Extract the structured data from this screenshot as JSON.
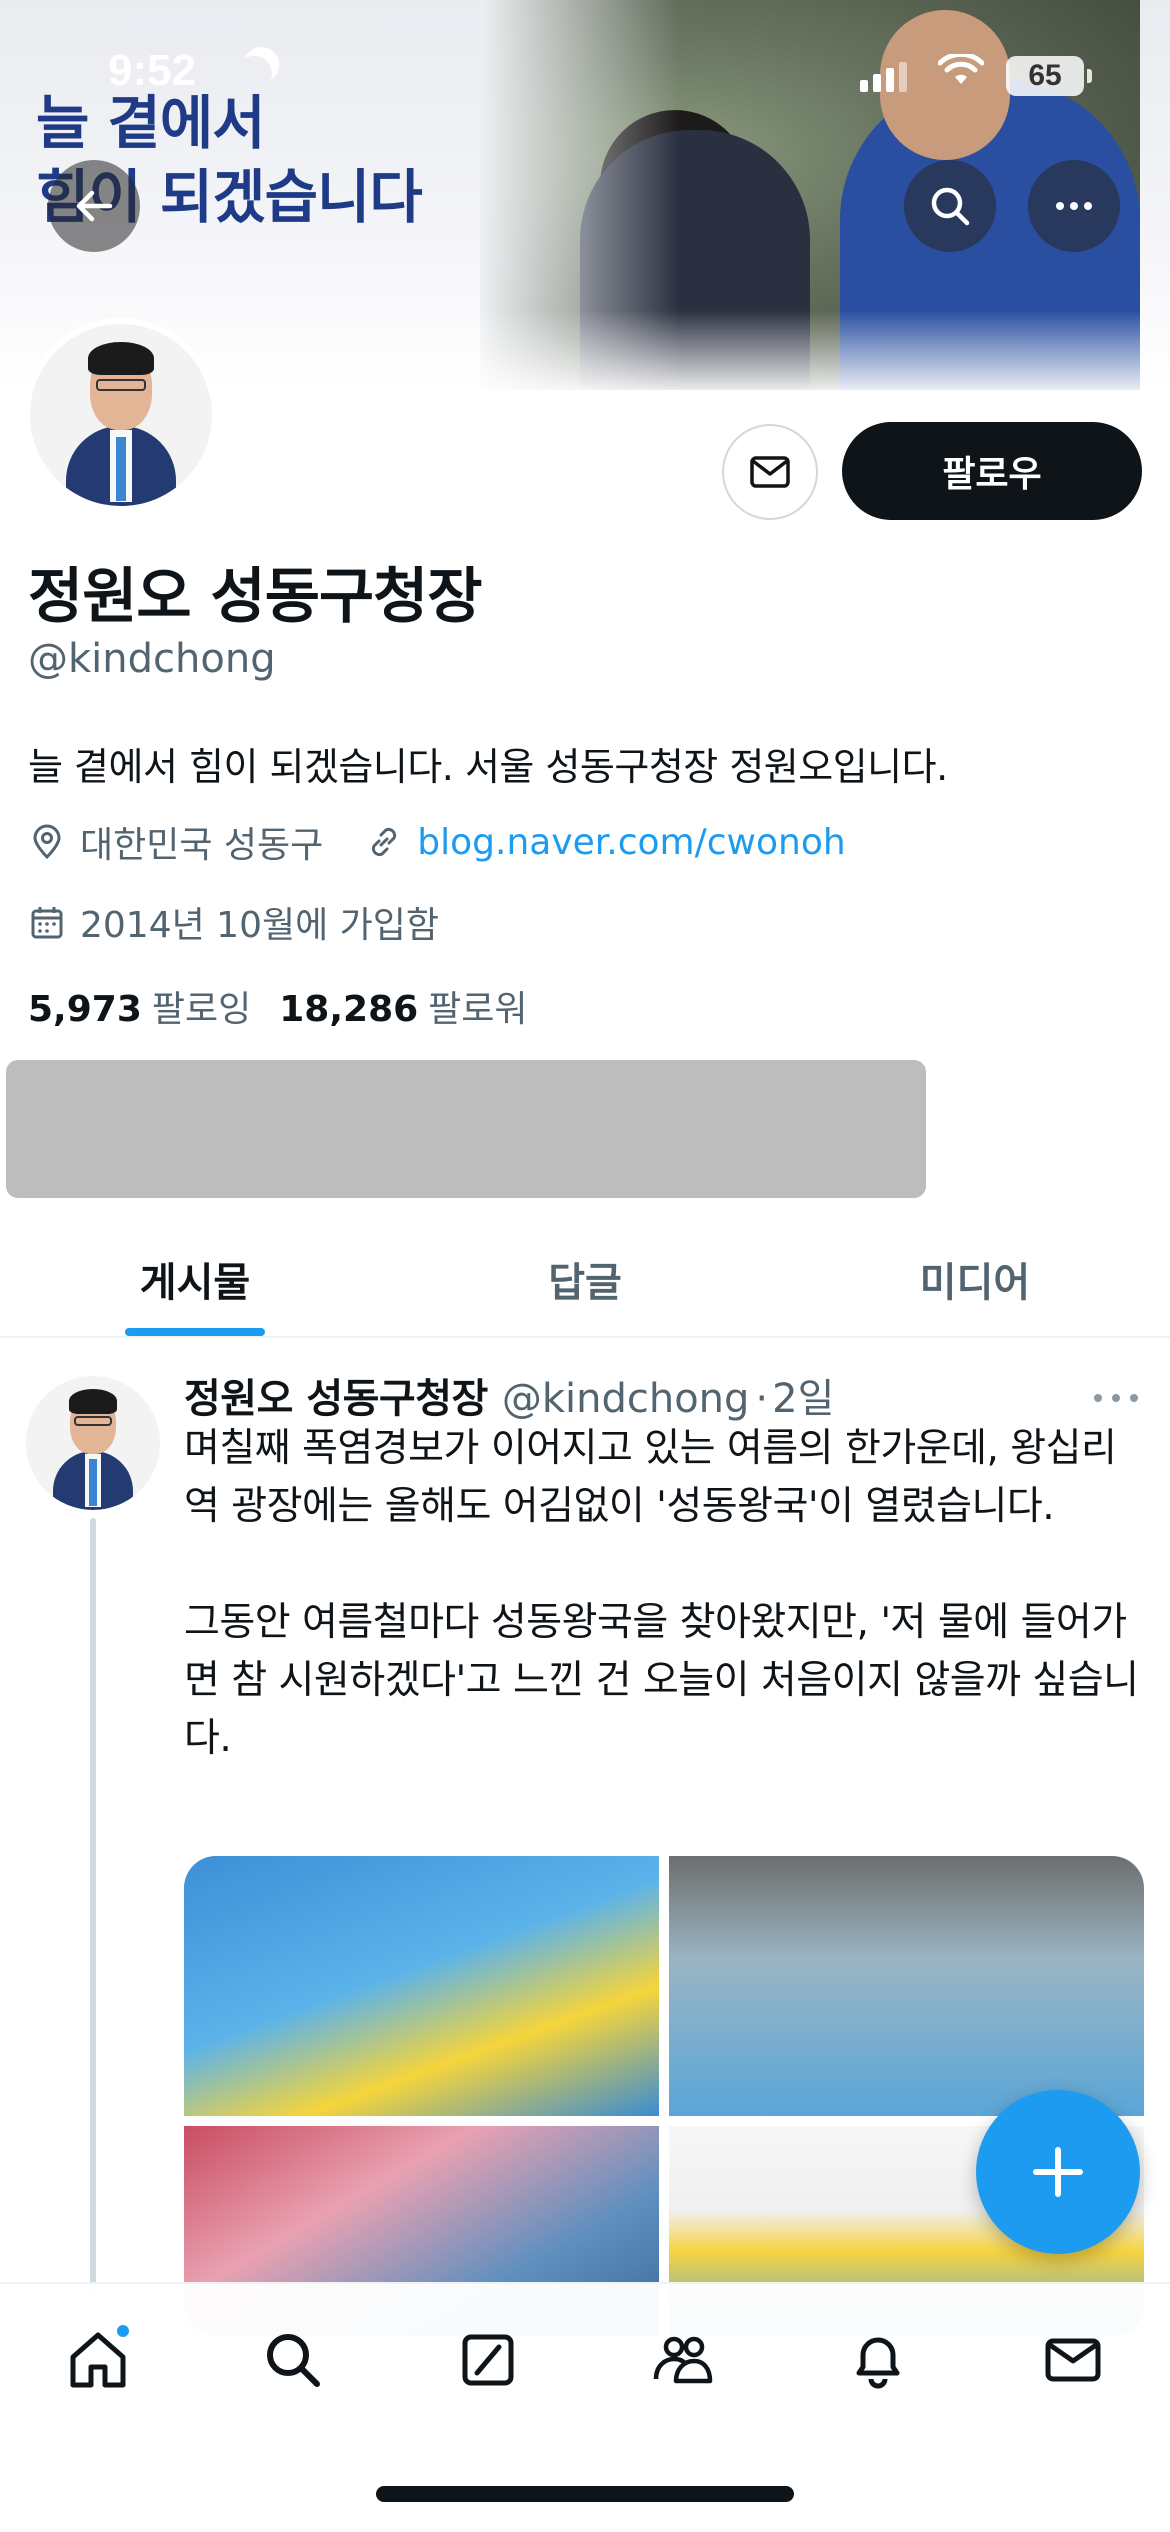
{
  "status_bar": {
    "time": "9:52",
    "battery": "65"
  },
  "banner": {
    "line1": "늘 곁에서",
    "line2": "힘이 되겠습니다"
  },
  "profile": {
    "name": "정원오 성동구청장",
    "handle": "@kindchong",
    "bio": "늘 곁에서 힘이 되겠습니다. 서울 성동구청장 정원오입니다.",
    "location": "대한민국 성동구",
    "website": "blog.naver.com/cwonoh",
    "joined": "2014년 10월에 가입함",
    "following_count": "5,973",
    "following_label": "팔로잉",
    "followers_count": "18,286",
    "followers_label": "팔로워",
    "follow_button": "팔로우"
  },
  "tabs": [
    {
      "label": "게시물",
      "active": true
    },
    {
      "label": "답글",
      "active": false
    },
    {
      "label": "미디어",
      "active": false
    }
  ],
  "post": {
    "author_name": "정원오 성동구청장",
    "author_handle": "@kindchong",
    "time": "2일",
    "text": "며칠째 폭염경보가 이어지고 있는 여름의 한가운데, 왕십리역 광장에는 올해도 어김없이 '성동왕국'이 열렸습니다.\n\n그동안 여름철마다 성동왕국을 찾아왔지만, '저 물에 들어가면 참 시원하겠다'고 느낀 건 오늘이 처음이지 않을까 싶습니다.",
    "media_count": 4
  },
  "icons": {
    "back": "back-arrow-icon",
    "search": "search-icon",
    "more": "more-icon",
    "message": "mail-icon",
    "location": "location-pin-icon",
    "link": "link-icon",
    "calendar": "calendar-icon",
    "compose": "plus-icon",
    "nav": [
      "home-icon",
      "search-icon",
      "grok-icon",
      "communities-icon",
      "notifications-icon",
      "messages-icon"
    ]
  },
  "colors": {
    "accent": "#1d9bf0",
    "text": "#0f1419",
    "secondary": "#536471"
  }
}
